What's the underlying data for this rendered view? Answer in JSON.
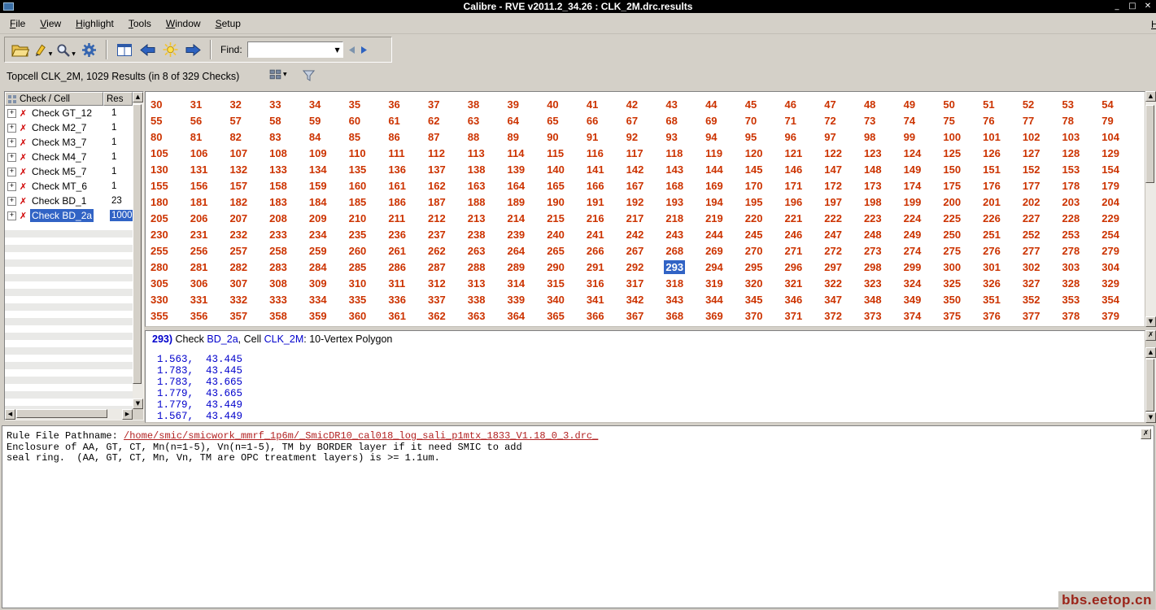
{
  "window": {
    "title": "Calibre - RVE v2011.2_34.26 : CLK_2M.drc.results",
    "controls": {
      "minimize": "_",
      "maximize": "□",
      "close": "✕"
    }
  },
  "menubar": {
    "items": [
      {
        "label": "File"
      },
      {
        "label": "View"
      },
      {
        "label": "Highlight"
      },
      {
        "label": "Tools"
      },
      {
        "label": "Window"
      },
      {
        "label": "Setup"
      }
    ],
    "help": {
      "label": "Help"
    }
  },
  "toolbar": {
    "find_label": "Find:",
    "find_value": ""
  },
  "results_header": {
    "text": "Topcell CLK_2M, 1029 Results (in 8 of 329 Checks)"
  },
  "tree": {
    "header": {
      "col1": "Check / Cell",
      "col2": "Res"
    },
    "items": [
      {
        "label": "Check GT_12",
        "res": "1",
        "selected": false
      },
      {
        "label": "Check M2_7",
        "res": "1",
        "selected": false
      },
      {
        "label": "Check M3_7",
        "res": "1",
        "selected": false
      },
      {
        "label": "Check M4_7",
        "res": "1",
        "selected": false
      },
      {
        "label": "Check M5_7",
        "res": "1",
        "selected": false
      },
      {
        "label": "Check MT_6",
        "res": "1",
        "selected": false
      },
      {
        "label": "Check BD_1",
        "res": "23",
        "selected": false
      },
      {
        "label": "Check BD_2a",
        "res": "1000",
        "selected": true
      }
    ]
  },
  "results_grid": {
    "first": 30,
    "last": 379,
    "columns": 25,
    "selected": 293
  },
  "detail_panel": {
    "header_segments": [
      {
        "text": "293)",
        "style": "num"
      },
      {
        "text": " Check ",
        "style": "plain"
      },
      {
        "text": "BD_2a",
        "style": "link"
      },
      {
        "text": ", Cell ",
        "style": "plain"
      },
      {
        "text": "CLK_2M",
        "style": "link"
      },
      {
        "text": ": 10-Vertex Polygon",
        "style": "plain"
      }
    ],
    "coordinates": [
      "1.563,  43.445",
      "1.783,  43.445",
      "1.783,  43.665",
      "1.779,  43.665",
      "1.779,  43.449",
      "1.567,  43.449"
    ]
  },
  "rule_panel": {
    "pathname_label": "Rule File Pathname: ",
    "pathname": "/home/smic/smicwork_mmrf_1p6m/_SmicDR10_cal018_log_sali_p1mtx_1833_V1.18_0_3.drc_",
    "description_lines": [
      "Enclosure of AA, GT, CT, Mn(n=1-5), Vn(n=1-5), TM by BORDER layer if it need SMIC to add",
      "seal ring.  (AA, GT, CT, Mn, Vn, TM are OPC treatment layers) is >= 1.1um."
    ]
  },
  "icons": {
    "open": "folder-open",
    "highlight": "highlighter",
    "search": "magnifier",
    "settings": "gear",
    "tile": "window-grid",
    "previous": "left-arrow",
    "clear_highlight": "sun",
    "next": "right-arrow",
    "find_prev": "◀",
    "find_next": "▶",
    "view_mode": "grid-squares",
    "filter": "funnel",
    "error": "✗",
    "expand": "+",
    "close": "✗"
  },
  "colors": {
    "result_number": "#cc3300",
    "selection": "#3163c5",
    "link": "#0000cc",
    "rule_path": "#b22222",
    "background": "#d4d0c8"
  },
  "watermark": "bbs.eetop.cn"
}
